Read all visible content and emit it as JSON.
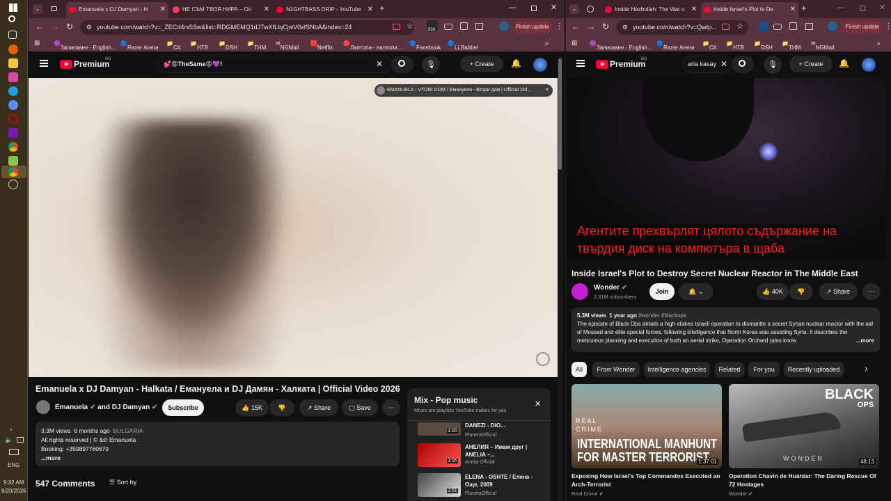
{
  "taskbar": {
    "time": "9:32 AM",
    "date": "8/20/2026",
    "lang": "ENG"
  },
  "left": {
    "tabs": [
      {
        "label": "Emanuela x DJ Damyan - H"
      },
      {
        "label": "НЕ СЪМ ТВОЯ НИРА – Огі"
      },
      {
        "label": "N1GHTBASS DRIP - YouTube"
      }
    ],
    "url": "youtube.com/watch?v=_ZECd4rs5Sw&list=RDGMEMQ1dJ7wXfLlqCjwV0xfSNbA&index=24",
    "update_label": "Finish update",
    "badge_count": "510",
    "bookmarks": [
      "Записване - English...",
      "Razer Arena",
      "C#",
      "НТВ",
      "DSH",
      "THM",
      "NGMail",
      "Netflix",
      "Лаптопи– лаптопи...",
      "Facebook",
      "LLBabbel"
    ],
    "brand": "Premium",
    "brand_sup": "BG",
    "search_value": "💕😡TheSame😡💜!",
    "create_label": "Create",
    "overlay_title": "EMANUELA - VTORI DOM / Емануела - Втори дом | Official Vid...",
    "video_title": "Emanuela x DJ Damyan - Halkata / Емануела и DJ Дамян - Халката | Official Video 2026",
    "channel": "Emanuela",
    "channel_and": "and DJ Damyan",
    "subscribe_label": "Subscribe",
    "likes": "15K",
    "share_label": "Share",
    "save_label": "Save",
    "views": "3.3M views",
    "age": "6 months ago",
    "country": "BULGARIA",
    "desc_line1": "All rights reserved |",
    "desc_line1b": "&",
    "desc_line1c": "Emanuela",
    "desc_line2": "Booking: +359897760679",
    "more": "...more",
    "comments": "547 Comments",
    "sort_label": "Sort by",
    "mix": {
      "title": "Mix - Pop music",
      "subtitle": "Mixes are playlists YouTube makes for you",
      "items": [
        {
          "title": "DANEZI - DIO...",
          "channel": "PlanetaOfficial",
          "duration": "3:06"
        },
        {
          "title": "АНЕЛИЯ – Имам друг | ANELIA –...",
          "channel": "Anelia Official",
          "duration": "3:06"
        },
        {
          "title": "ELENA - OSHTE / Елена - Още, 2009",
          "channel": "PlanetaOfficial",
          "duration": "3:51"
        }
      ]
    }
  },
  "right": {
    "tabs": [
      {
        "label": "Inside Hezbollah: The War o"
      },
      {
        "label": "Inside Israel's Plot to De"
      }
    ],
    "url": "youtube.com/watch?v=Qwtp...",
    "update_label": "Finish update",
    "bookmarks": [
      "Записване - English...",
      "Razer Arena",
      "C#",
      "НТВ",
      "DSH",
      "THM",
      "NGMail"
    ],
    "brand": "Premium",
    "brand_sup": "BG",
    "search_value": "aria kasay",
    "create_label": "Create",
    "subtitle_line1": "Агентите прехвърлят цялото съдържание на",
    "subtitle_line2": "твърдия диск на компютъра в щаба",
    "video_title": "Inside Israel's Plot to Destroy Secret Nuclear Reactor in The Middle East",
    "channel": "Wonder",
    "subs": "2.31M subscribers",
    "join_label": "Join",
    "likes": "40K",
    "share_label": "Share",
    "views": "5.3M views",
    "age": "1 year ago",
    "tags": "#wonder #blackops",
    "desc": "The episode of Black Ops details a high-stakes Israeli operation to dismantle a secret Syrian nuclear reactor with the aid of Mossad and elite special forces, following intelligence that North Korea was assisting Syria. It describes the meticulous planning and execution of both an aerial strike, Operation Orchard (also know",
    "more": "...more",
    "chips": [
      "All",
      "From Wonder",
      "Intelligence agencies",
      "Related",
      "For you",
      "Recently uploaded"
    ],
    "related": [
      {
        "thumb_top": "REAL",
        "thumb_top2": "CRIME",
        "thumb_big": "INTERNATIONAL MANHUNT",
        "thumb_big2": "FOR MASTER TERRORIST",
        "duration": "1:37:01",
        "title": "Exposing How Israel's Top Commandos Executed an Arch-Terrorist",
        "channel": "Real Crime"
      },
      {
        "thumb_top": "BLACK",
        "thumb_top2": "OPS",
        "thumb_big": "WONDER",
        "duration": "48:13",
        "title": "Operation Chavín de Huántar: The Daring Rescue Of 72 Hostages",
        "channel": "Wonder"
      }
    ]
  }
}
